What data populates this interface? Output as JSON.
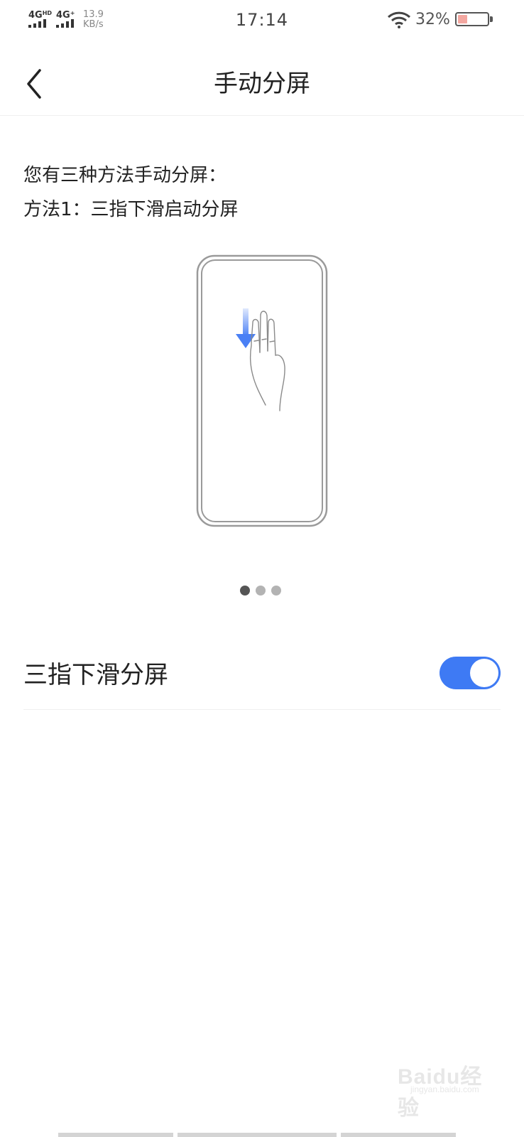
{
  "status_bar": {
    "signal1": {
      "label": "4G",
      "sup": "HD"
    },
    "signal2": {
      "label": "4G",
      "sup": "+"
    },
    "net_speed_value": "13.9",
    "net_speed_unit": "KB/s",
    "time": "17:14",
    "battery_percent": "32%",
    "battery_level": 0.32,
    "battery_color": "#f3a7a0"
  },
  "header": {
    "title": "手动分屏",
    "back_icon": "chevron-left-icon"
  },
  "content": {
    "intro": "您有三种方法手动分屏：",
    "method": "方法1：三指下滑启动分屏",
    "illustration_icons": [
      "phone-outline-icon",
      "down-arrow-icon",
      "three-finger-hand-icon"
    ],
    "arrow_color": "#4a80f5",
    "pager": {
      "total": 3,
      "active": 1
    }
  },
  "setting": {
    "label": "三指下滑分屏",
    "toggle_on": true,
    "accent_color": "#3e7af4"
  },
  "watermark": {
    "text": "Baidu经验",
    "sub": "jingyan.baidu.com"
  }
}
